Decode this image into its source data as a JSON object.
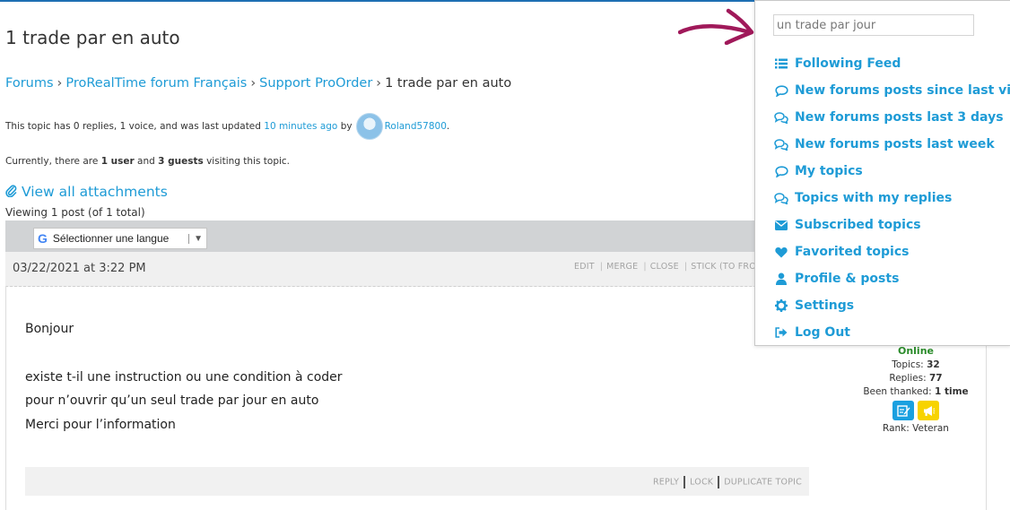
{
  "topic": {
    "title": "1 trade par en auto",
    "breadcrumbs": [
      "Forums",
      "ProRealTime forum Français",
      "Support ProOrder"
    ],
    "breadcrumb_current": "1 trade par en auto",
    "breadcrumb_sep": "›",
    "meta_prefix": "This topic has 0 replies, 1 voice, and was last updated",
    "meta_time": "10 minutes ago",
    "meta_by": "by",
    "meta_user": "Roland57800",
    "meta_end": ".",
    "visitors_prefix": "Currently, there are",
    "visitors_users": "1 user",
    "visitors_and": "and",
    "visitors_guests": "3 guests",
    "visitors_suffix": "visiting this topic.",
    "attachments_label": "View all attachments",
    "viewing": "Viewing 1 post (of 1 total)"
  },
  "language_select": {
    "google_mark": "G",
    "label": "Sélectionner une langue",
    "caret": "▼"
  },
  "post": {
    "date": "03/22/2021 at 3:22 PM",
    "actions": [
      "EDIT",
      "MERGE",
      "CLOSE",
      "STICK (TO FRONT)"
    ],
    "greeting": "Bonjour",
    "lines": [
      "existe t-il une instruction ou une condition à coder",
      "pour n’ouvrir qu’un seul trade par jour en auto",
      "Merci pour l’information"
    ],
    "footer_links": [
      "REPLY",
      "LOCK",
      "DUPLICATE TOPIC"
    ]
  },
  "author": {
    "status": "Online",
    "topics_label": "Topics:",
    "topics": "32",
    "replies_label": "Replies:",
    "replies": "77",
    "thanked_label": "Been thanked:",
    "thanked": "1 time",
    "rank": "Rank: Veteran"
  },
  "menu": {
    "search_value": "un trade par jour",
    "items": [
      {
        "label": "Following Feed",
        "icon": "list-icon"
      },
      {
        "label": "New forums posts since last visit",
        "icon": "comment-icon"
      },
      {
        "label": "New forums posts last 3 days",
        "icon": "comments-icon"
      },
      {
        "label": "New forums posts last week",
        "icon": "comments-icon"
      },
      {
        "label": "My topics",
        "icon": "comment-icon"
      },
      {
        "label": "Topics with my replies",
        "icon": "comments-icon"
      },
      {
        "label": "Subscribed topics",
        "icon": "envelope-icon"
      },
      {
        "label": "Favorited topics",
        "icon": "heart-icon"
      },
      {
        "label": "Profile & posts",
        "icon": "user-icon"
      },
      {
        "label": "Settings",
        "icon": "gear-icon"
      },
      {
        "label": "Log Out",
        "icon": "logout-icon"
      }
    ]
  },
  "colors": {
    "link": "#1e9bd6",
    "online": "#2a8b2a",
    "arrow": "#a0195a",
    "badge_blue": "#1aa0e0",
    "badge_yellow": "#f7d300"
  }
}
